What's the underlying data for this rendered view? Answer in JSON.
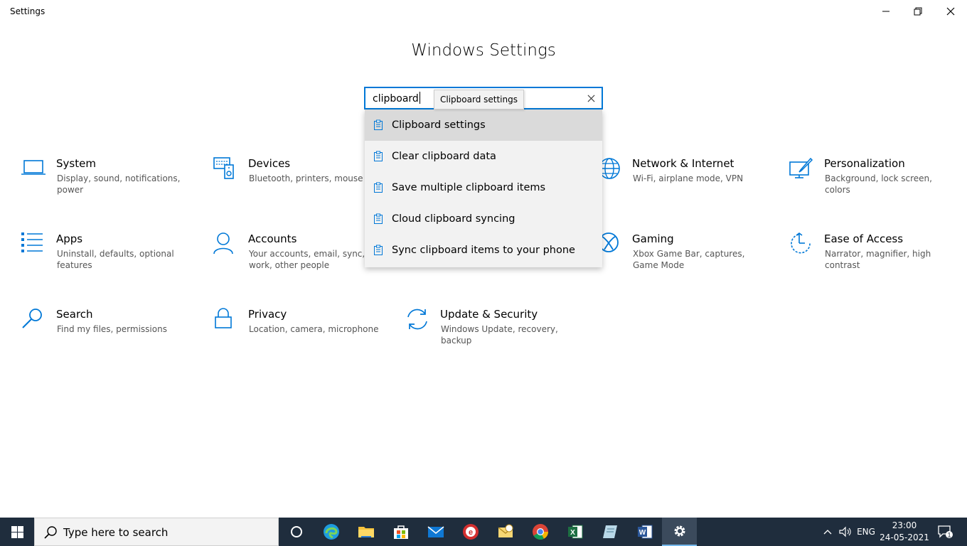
{
  "window": {
    "title": "Settings"
  },
  "page": {
    "heading": "Windows Settings"
  },
  "search": {
    "value": "clipboard",
    "tooltip": "Clipboard settings",
    "suggestions": [
      {
        "label": "Clipboard settings",
        "selected": true
      },
      {
        "label": "Clear clipboard data",
        "selected": false
      },
      {
        "label": "Save multiple clipboard items",
        "selected": false
      },
      {
        "label": "Cloud clipboard syncing",
        "selected": false
      },
      {
        "label": "Sync clipboard items to your phone",
        "selected": false
      }
    ]
  },
  "categories": [
    {
      "icon": "laptop-icon",
      "title": "System",
      "desc": "Display, sound, notifications, power"
    },
    {
      "icon": "devices-icon",
      "title": "Devices",
      "desc": "Bluetooth, printers, mouse"
    },
    {
      "icon": "globe-icon",
      "title": "Network & Internet",
      "desc": "Wi-Fi, airplane mode, VPN"
    },
    {
      "icon": "personalization-icon",
      "title": "Personalization",
      "desc": "Background, lock screen, colors"
    },
    {
      "icon": "apps-icon",
      "title": "Apps",
      "desc": "Uninstall, defaults, optional features"
    },
    {
      "icon": "person-icon",
      "title": "Accounts",
      "desc": "Your accounts, email, sync, work, other people"
    },
    {
      "icon": "xbox-icon",
      "title": "Gaming",
      "desc": "Xbox Game Bar, captures, Game Mode"
    },
    {
      "icon": "ease-of-access-icon",
      "title": "Ease of Access",
      "desc": "Narrator, magnifier, high contrast"
    },
    {
      "icon": "search-icon",
      "title": "Search",
      "desc": "Find my files, permissions"
    },
    {
      "icon": "lock-icon",
      "title": "Privacy",
      "desc": "Location, camera, microphone"
    },
    {
      "icon": "sync-icon",
      "title": "Update & Security",
      "desc": "Windows Update, recovery, backup"
    }
  ],
  "taskbar": {
    "search_placeholder": "Type here to search",
    "language": "ENG",
    "time": "23:00",
    "date": "24-05-2021",
    "notification_count": "1"
  },
  "colors": {
    "accent": "#0078d7",
    "taskbar": "#1f2d3d"
  }
}
